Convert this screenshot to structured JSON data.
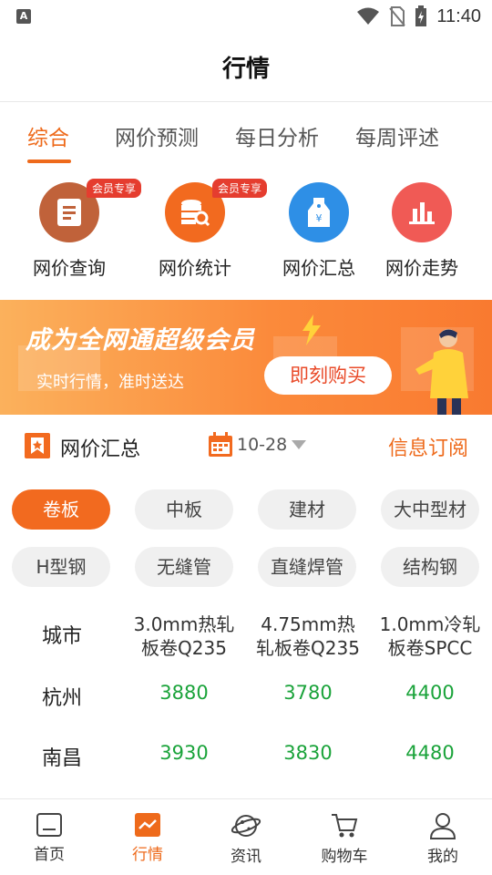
{
  "status_bar": {
    "time": "11:40",
    "left_icon_text": "A"
  },
  "header": {
    "title": "行情"
  },
  "tabs": [
    {
      "label": "综合",
      "active": true
    },
    {
      "label": "网价预测",
      "active": false
    },
    {
      "label": "每日分析",
      "active": false
    },
    {
      "label": "每周评述",
      "active": false
    }
  ],
  "quick_actions": [
    {
      "label": "网价查询",
      "badge": "会员专享",
      "icon": "document-icon",
      "color": "#c0623a"
    },
    {
      "label": "网价统计",
      "badge": "会员专享",
      "icon": "database-search-icon",
      "color": "#f26a1f"
    },
    {
      "label": "网价汇总",
      "icon": "price-tag-icon",
      "color": "#2e8fe6"
    },
    {
      "label": "网价走势",
      "icon": "bar-chart-icon",
      "color": "#f05a55"
    }
  ],
  "banner": {
    "headline": "成为全网通超级会员",
    "subtitle": "实时行情，准时送达",
    "button": "即刻购买"
  },
  "summary": {
    "title": "网价汇总",
    "date": "10-28",
    "subscribe": "信息订阅"
  },
  "categories": [
    {
      "label": "卷板",
      "active": true
    },
    {
      "label": "中板",
      "active": false
    },
    {
      "label": "建材",
      "active": false
    },
    {
      "label": "大中型材",
      "active": false
    },
    {
      "label": "H型钢",
      "active": false
    },
    {
      "label": "无缝管",
      "active": false
    },
    {
      "label": "直缝焊管",
      "active": false
    },
    {
      "label": "结构钢",
      "active": false
    }
  ],
  "price_table": {
    "headers": [
      "城市",
      [
        "3.0mm热轧",
        "板卷Q235"
      ],
      [
        "4.75mm热",
        "轧板卷Q235"
      ],
      [
        "1.0mm冷轧",
        "板卷SPCC"
      ]
    ],
    "rows": [
      {
        "city": "杭州",
        "prices": [
          "3880",
          "3780",
          "4400"
        ]
      },
      {
        "city": "南昌",
        "prices": [
          "3930",
          "3830",
          "4480"
        ]
      }
    ]
  },
  "bottom_nav": [
    {
      "label": "首页",
      "icon": "home-icon",
      "active": false
    },
    {
      "label": "行情",
      "icon": "market-chart-icon",
      "active": true
    },
    {
      "label": "资讯",
      "icon": "news-planet-icon",
      "active": false
    },
    {
      "label": "购物车",
      "icon": "cart-icon",
      "active": false
    },
    {
      "label": "我的",
      "icon": "profile-icon",
      "active": false
    }
  ],
  "colors": {
    "accent": "#ee6a1b",
    "price_green": "#1aa33a",
    "badge_red": "#e53d2f"
  }
}
